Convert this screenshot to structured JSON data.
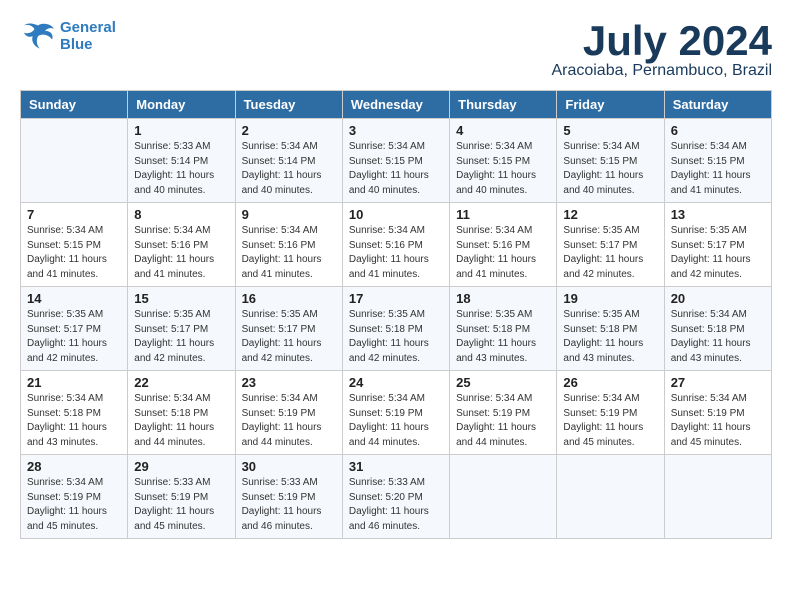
{
  "header": {
    "logo_line1": "General",
    "logo_line2": "Blue",
    "month_title": "July 2024",
    "location": "Aracoiaba, Pernambuco, Brazil"
  },
  "days_of_week": [
    "Sunday",
    "Monday",
    "Tuesday",
    "Wednesday",
    "Thursday",
    "Friday",
    "Saturday"
  ],
  "weeks": [
    [
      {
        "num": "",
        "info": ""
      },
      {
        "num": "1",
        "info": "Sunrise: 5:33 AM\nSunset: 5:14 PM\nDaylight: 11 hours\nand 40 minutes."
      },
      {
        "num": "2",
        "info": "Sunrise: 5:34 AM\nSunset: 5:14 PM\nDaylight: 11 hours\nand 40 minutes."
      },
      {
        "num": "3",
        "info": "Sunrise: 5:34 AM\nSunset: 5:15 PM\nDaylight: 11 hours\nand 40 minutes."
      },
      {
        "num": "4",
        "info": "Sunrise: 5:34 AM\nSunset: 5:15 PM\nDaylight: 11 hours\nand 40 minutes."
      },
      {
        "num": "5",
        "info": "Sunrise: 5:34 AM\nSunset: 5:15 PM\nDaylight: 11 hours\nand 40 minutes."
      },
      {
        "num": "6",
        "info": "Sunrise: 5:34 AM\nSunset: 5:15 PM\nDaylight: 11 hours\nand 41 minutes."
      }
    ],
    [
      {
        "num": "7",
        "info": "Sunrise: 5:34 AM\nSunset: 5:15 PM\nDaylight: 11 hours\nand 41 minutes."
      },
      {
        "num": "8",
        "info": "Sunrise: 5:34 AM\nSunset: 5:16 PM\nDaylight: 11 hours\nand 41 minutes."
      },
      {
        "num": "9",
        "info": "Sunrise: 5:34 AM\nSunset: 5:16 PM\nDaylight: 11 hours\nand 41 minutes."
      },
      {
        "num": "10",
        "info": "Sunrise: 5:34 AM\nSunset: 5:16 PM\nDaylight: 11 hours\nand 41 minutes."
      },
      {
        "num": "11",
        "info": "Sunrise: 5:34 AM\nSunset: 5:16 PM\nDaylight: 11 hours\nand 41 minutes."
      },
      {
        "num": "12",
        "info": "Sunrise: 5:35 AM\nSunset: 5:17 PM\nDaylight: 11 hours\nand 42 minutes."
      },
      {
        "num": "13",
        "info": "Sunrise: 5:35 AM\nSunset: 5:17 PM\nDaylight: 11 hours\nand 42 minutes."
      }
    ],
    [
      {
        "num": "14",
        "info": "Sunrise: 5:35 AM\nSunset: 5:17 PM\nDaylight: 11 hours\nand 42 minutes."
      },
      {
        "num": "15",
        "info": "Sunrise: 5:35 AM\nSunset: 5:17 PM\nDaylight: 11 hours\nand 42 minutes."
      },
      {
        "num": "16",
        "info": "Sunrise: 5:35 AM\nSunset: 5:17 PM\nDaylight: 11 hours\nand 42 minutes."
      },
      {
        "num": "17",
        "info": "Sunrise: 5:35 AM\nSunset: 5:18 PM\nDaylight: 11 hours\nand 42 minutes."
      },
      {
        "num": "18",
        "info": "Sunrise: 5:35 AM\nSunset: 5:18 PM\nDaylight: 11 hours\nand 43 minutes."
      },
      {
        "num": "19",
        "info": "Sunrise: 5:35 AM\nSunset: 5:18 PM\nDaylight: 11 hours\nand 43 minutes."
      },
      {
        "num": "20",
        "info": "Sunrise: 5:34 AM\nSunset: 5:18 PM\nDaylight: 11 hours\nand 43 minutes."
      }
    ],
    [
      {
        "num": "21",
        "info": "Sunrise: 5:34 AM\nSunset: 5:18 PM\nDaylight: 11 hours\nand 43 minutes."
      },
      {
        "num": "22",
        "info": "Sunrise: 5:34 AM\nSunset: 5:18 PM\nDaylight: 11 hours\nand 44 minutes."
      },
      {
        "num": "23",
        "info": "Sunrise: 5:34 AM\nSunset: 5:19 PM\nDaylight: 11 hours\nand 44 minutes."
      },
      {
        "num": "24",
        "info": "Sunrise: 5:34 AM\nSunset: 5:19 PM\nDaylight: 11 hours\nand 44 minutes."
      },
      {
        "num": "25",
        "info": "Sunrise: 5:34 AM\nSunset: 5:19 PM\nDaylight: 11 hours\nand 44 minutes."
      },
      {
        "num": "26",
        "info": "Sunrise: 5:34 AM\nSunset: 5:19 PM\nDaylight: 11 hours\nand 45 minutes."
      },
      {
        "num": "27",
        "info": "Sunrise: 5:34 AM\nSunset: 5:19 PM\nDaylight: 11 hours\nand 45 minutes."
      }
    ],
    [
      {
        "num": "28",
        "info": "Sunrise: 5:34 AM\nSunset: 5:19 PM\nDaylight: 11 hours\nand 45 minutes."
      },
      {
        "num": "29",
        "info": "Sunrise: 5:33 AM\nSunset: 5:19 PM\nDaylight: 11 hours\nand 45 minutes."
      },
      {
        "num": "30",
        "info": "Sunrise: 5:33 AM\nSunset: 5:19 PM\nDaylight: 11 hours\nand 46 minutes."
      },
      {
        "num": "31",
        "info": "Sunrise: 5:33 AM\nSunset: 5:20 PM\nDaylight: 11 hours\nand 46 minutes."
      },
      {
        "num": "",
        "info": ""
      },
      {
        "num": "",
        "info": ""
      },
      {
        "num": "",
        "info": ""
      }
    ]
  ]
}
